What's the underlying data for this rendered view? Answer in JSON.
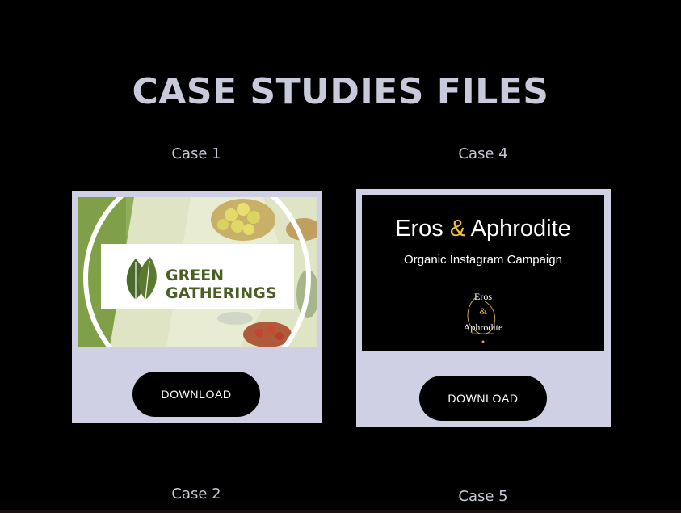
{
  "page": {
    "title": "CASE STUDIES FILES"
  },
  "cases": [
    {
      "label": "Case 1",
      "logo_line1": "GREEN",
      "logo_line2": "GATHERINGS",
      "button_label": "DOWNLOAD"
    },
    {
      "label": "Case 4",
      "brand_left": "Eros",
      "brand_amp": "&",
      "brand_right": "Aphrodite",
      "subtitle": "Organic Instagram Campaign",
      "logo_line1": "Eros",
      "logo_line2": "&",
      "logo_line3": "Aphrodite",
      "button_label": "DOWNLOAD"
    },
    {
      "label": "Case 2"
    },
    {
      "label": "Case 5"
    }
  ],
  "colors": {
    "background": "#000000",
    "card": "#cfd0e3",
    "title": "#c9c9dc",
    "accent_gold": "#f0c040",
    "logo_green": "#4a5f23"
  },
  "icons": {
    "green_logo": "leaf-icon",
    "eros_logo": "eros-aphrodite-logo-icon"
  }
}
